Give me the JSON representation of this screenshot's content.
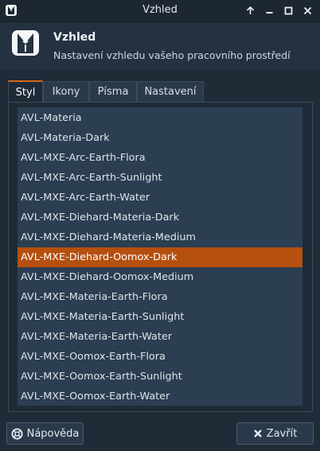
{
  "window": {
    "title": "Vzhled"
  },
  "header": {
    "title": "Vzhled",
    "subtitle": "Nastavení vzhledu vašeho pracovního prostředí"
  },
  "tabs": [
    {
      "label": "Styl",
      "active": true
    },
    {
      "label": "Ikony",
      "active": false
    },
    {
      "label": "Písma",
      "active": false
    },
    {
      "label": "Nastavení",
      "active": false
    }
  ],
  "styles": [
    "AVL-Materia",
    "AVL-Materia-Dark",
    "AVL-MXE-Arc-Earth-Flora",
    "AVL-MXE-Arc-Earth-Sunlight",
    "AVL-MXE-Arc-Earth-Water",
    "AVL-MXE-Diehard-Materia-Dark",
    "AVL-MXE-Diehard-Materia-Medium",
    "AVL-MXE-Diehard-Oomox-Dark",
    "AVL-MXE-Diehard-Oomox-Medium",
    "AVL-MXE-Materia-Earth-Flora",
    "AVL-MXE-Materia-Earth-Sunlight",
    "AVL-MXE-Materia-Earth-Water",
    "AVL-MXE-Oomox-Earth-Flora",
    "AVL-MXE-Oomox-Earth-Sunlight",
    "AVL-MXE-Oomox-Earth-Water"
  ],
  "selected_style": "AVL-MXE-Diehard-Oomox-Dark",
  "buttons": {
    "help": "Nápověda",
    "close": "Zavřít"
  },
  "colors": {
    "accent": "#d2681c",
    "selection": "#b5500e",
    "list_bg": "#2c3e51"
  },
  "icons": {
    "app": "tuxedo-icon",
    "help": "lifebuoy-icon",
    "close": "x-icon"
  }
}
